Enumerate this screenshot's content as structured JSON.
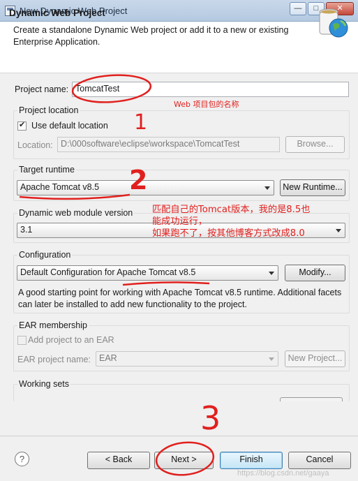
{
  "window": {
    "title": "New Dynamic Web Project",
    "minimize": "—",
    "maximize": "□",
    "close": "✕"
  },
  "header": {
    "title": "Dynamic Web Project",
    "description": "Create a standalone Dynamic Web project or add it to a new or existing Enterprise Application."
  },
  "project": {
    "name_label": "Project name:",
    "name_value": "TomcatTest"
  },
  "location": {
    "group_label": "Project location",
    "use_default_label": "Use default location",
    "use_default_checked": true,
    "location_label": "Location:",
    "location_value": "D:\\000software\\eclipse\\workspace\\TomcatTest",
    "browse_label": "Browse..."
  },
  "target_runtime": {
    "group_label": "Target runtime",
    "selected": "Apache Tomcat v8.5",
    "new_runtime_label": "New Runtime..."
  },
  "module_version": {
    "group_label": "Dynamic web module version",
    "selected": "3.1"
  },
  "configuration": {
    "group_label": "Configuration",
    "selected": "Default Configuration for Apache Tomcat v8.5",
    "modify_label": "Modify...",
    "description": "A good starting point for working with Apache Tomcat v8.5 runtime. Additional facets can later be installed to add new functionality to the project."
  },
  "ear": {
    "group_label": "EAR membership",
    "add_label": "Add project to an EAR",
    "add_checked": false,
    "project_name_label": "EAR project name:",
    "project_name_value": "EAR",
    "new_project_label": "New Project..."
  },
  "working_sets": {
    "group_label": "Working sets"
  },
  "footer": {
    "help": "?",
    "back_label": "< Back",
    "next_label": "Next >",
    "finish_label": "Finish",
    "cancel_label": "Cancel"
  },
  "annotations": {
    "web_name_note": "Web 项目包的名称",
    "step1": "1",
    "step2": "2",
    "step3": "3",
    "tomcat_note_line1": "匹配自己的Tomcat版本，我的是8.5也",
    "tomcat_note_line2": "能成功运行，",
    "tomcat_note_line3": "如果跑不了，按其他博客方式改成8.0"
  },
  "watermark": "https://blog.csdn.net/gaaya",
  "colors": {
    "annotation": "#e0201e",
    "titlebar": "#b4c9e1"
  }
}
